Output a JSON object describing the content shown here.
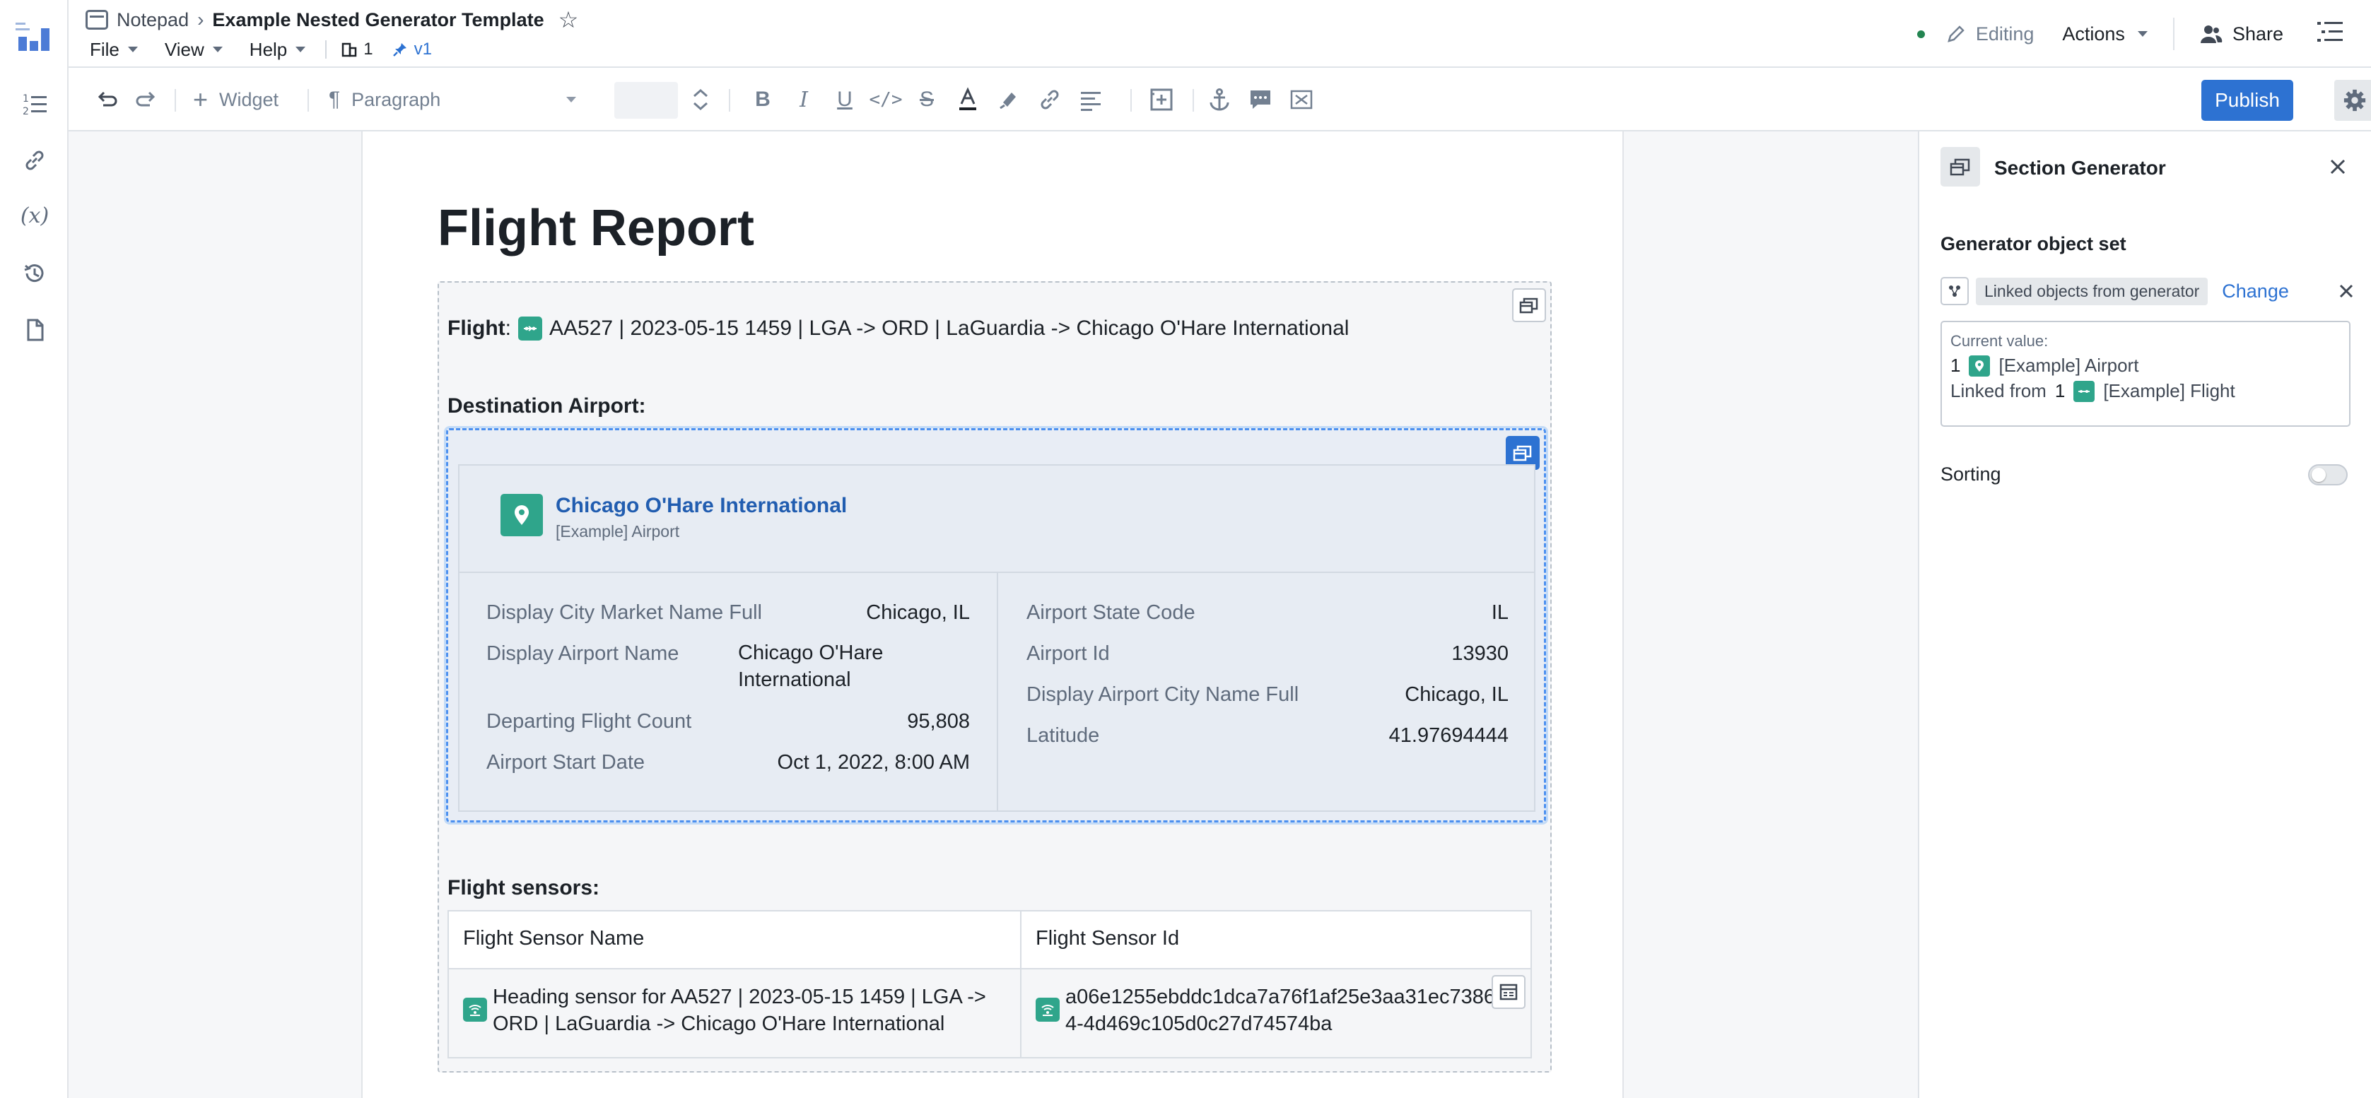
{
  "colors": {
    "accent": "#2d72d2",
    "object_chip": "#2fa58b",
    "status_online": "#238551",
    "link_title": "#215db0"
  },
  "breadcrumb": {
    "parent": "Notepad",
    "title": "Example Nested Generator Template",
    "icon": "notepad-icon"
  },
  "menu": {
    "file": "File",
    "view": "View",
    "help": "Help",
    "count": "1",
    "version": "v1"
  },
  "header": {
    "editing": "Editing",
    "actions": "Actions",
    "share": "Share"
  },
  "toolbar": {
    "widget": "Widget",
    "paragraph": "Paragraph",
    "publish": "Publish"
  },
  "document": {
    "title": "Flight Report",
    "flight_label": "Flight",
    "flight_value": "AA527 | 2023-05-15 1459 | LGA -> ORD | LaGuardia -> Chicago O'Hare International",
    "destination_label": "Destination Airport:",
    "airport_card": {
      "title": "Chicago O'Hare International",
      "subtitle": "[Example] Airport",
      "left_props": [
        {
          "key": "Display City Market Name Full",
          "value": "Chicago, IL"
        },
        {
          "key": "Display Airport Name",
          "value": "Chicago O'Hare International"
        },
        {
          "key": "Departing Flight Count",
          "value": "95,808"
        },
        {
          "key": "Airport Start Date",
          "value": "Oct 1, 2022, 8:00 AM"
        }
      ],
      "right_props": [
        {
          "key": "Airport State Code",
          "value": "IL"
        },
        {
          "key": "Airport Id",
          "value": "13930"
        },
        {
          "key": "Display Airport City Name Full",
          "value": "Chicago, IL"
        },
        {
          "key": "Latitude",
          "value": "41.97694444"
        }
      ]
    },
    "sensors_label": "Flight sensors:",
    "sensor_table": {
      "columns": [
        "Flight Sensor Name",
        "Flight Sensor Id"
      ],
      "rows": [
        {
          "name": "Heading sensor for AA527 | 2023-05-15 1459 | LGA -> ORD | LaGuardia -> Chicago O'Hare International",
          "id": "a06e1255ebddc1dca7a76f1af25e3aa31ec738654-4d469c105d0c27d74574ba"
        }
      ]
    }
  },
  "panel": {
    "title": "Section Generator",
    "object_set_label": "Generator object set",
    "tag": "Linked objects from generator",
    "change": "Change",
    "current_value_label": "Current value:",
    "line1_count": "1",
    "line1_type": "[Example] Airport",
    "line2_prefix": "Linked from",
    "line2_count": "1",
    "line2_type": "[Example] Flight",
    "sorting": "Sorting"
  }
}
